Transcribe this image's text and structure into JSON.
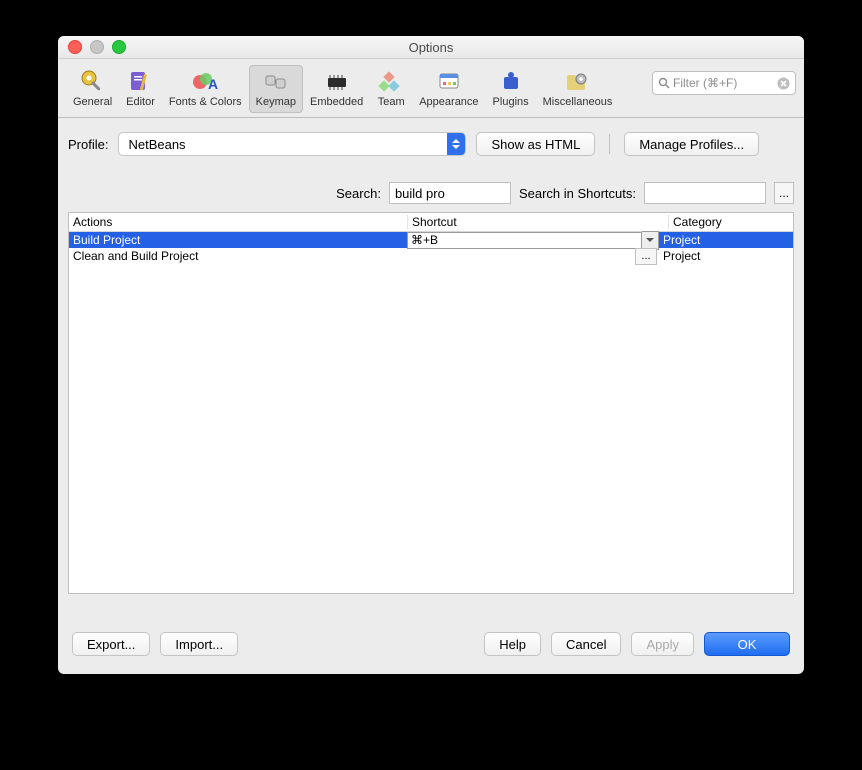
{
  "window": {
    "title": "Options"
  },
  "filter": {
    "placeholder": "Filter (⌘+F)"
  },
  "toolbar_tabs": {
    "general": {
      "label": "General"
    },
    "editor": {
      "label": "Editor"
    },
    "fonts_colors": {
      "label": "Fonts & Colors"
    },
    "keymap": {
      "label": "Keymap"
    },
    "embedded": {
      "label": "Embedded"
    },
    "team": {
      "label": "Team"
    },
    "appearance": {
      "label": "Appearance"
    },
    "plugins": {
      "label": "Plugins"
    },
    "miscellaneous": {
      "label": "Miscellaneous"
    }
  },
  "profile": {
    "label": "Profile:",
    "selected": "NetBeans",
    "show_as_html": "Show as HTML",
    "manage": "Manage Profiles..."
  },
  "search": {
    "label": "Search:",
    "value": "build pro",
    "shortcuts_label": "Search in Shortcuts:",
    "shortcuts_value": "",
    "ellipsis": "..."
  },
  "table": {
    "headers": {
      "actions": "Actions",
      "shortcut": "Shortcut",
      "category": "Category"
    },
    "rows": [
      {
        "action": "Build Project",
        "shortcut": "⌘+B",
        "category": "Project",
        "selected": true,
        "editing": true
      },
      {
        "action": "Clean and Build Project",
        "shortcut": "",
        "category": "Project",
        "selected": false,
        "editing": false
      }
    ]
  },
  "buttons": {
    "export": "Export...",
    "import": "Import...",
    "help": "Help",
    "cancel": "Cancel",
    "apply": "Apply",
    "ok": "OK"
  }
}
